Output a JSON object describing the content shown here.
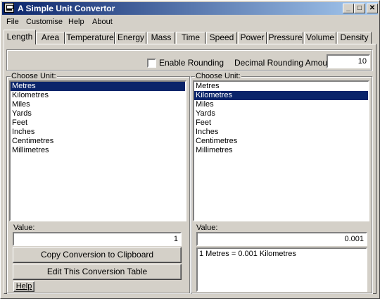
{
  "window": {
    "title": "A Simple Unit Convertor",
    "buttons": {
      "minimize": "_",
      "maximize": "□",
      "close": "✕"
    }
  },
  "menu": [
    "File",
    "Customise",
    "Help",
    "About"
  ],
  "tabs": [
    "Length",
    "Area",
    "Temperature",
    "Energy",
    "Mass",
    "Time",
    "Speed",
    "Power",
    "Pressure",
    "Volume",
    "Density"
  ],
  "active_tab": "Length",
  "options": {
    "enable_rounding_label": "Enable Rounding",
    "enable_rounding_checked": false,
    "decimal_rounding_label": "Decimal Rounding Amount:",
    "decimal_rounding_value": "10"
  },
  "left": {
    "group_label": "Choose Unit:",
    "units": [
      "Metres",
      "Kilometres",
      "Miles",
      "Yards",
      "Feet",
      "Inches",
      "Centimetres",
      "Millimetres"
    ],
    "selected": "Metres",
    "value_label": "Value:",
    "value": "1",
    "copy_button": "Copy Conversion to Clipboard",
    "edit_button": "Edit This Conversion Table",
    "help_button": "Help"
  },
  "right": {
    "group_label": "Choose Unit:",
    "units": [
      "Metres",
      "Kilometres",
      "Miles",
      "Yards",
      "Feet",
      "Inches",
      "Centimetres",
      "Millimetres"
    ],
    "selected": "Kilometres",
    "value_label": "Value:",
    "value": "0.001",
    "result_text": "1 Metres = 0.001 Kilometres"
  }
}
